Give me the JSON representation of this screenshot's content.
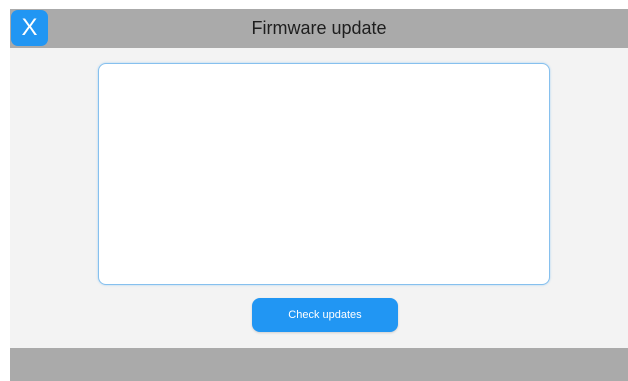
{
  "window": {
    "title": "Firmware update",
    "close_label": "X"
  },
  "main": {
    "content_text": "",
    "check_updates_label": "Check updates"
  },
  "colors": {
    "accent": "#2196f3",
    "title_bar": "#aaaaaa",
    "background": "#f3f3f3"
  },
  "icons": {
    "close": "close-icon"
  }
}
